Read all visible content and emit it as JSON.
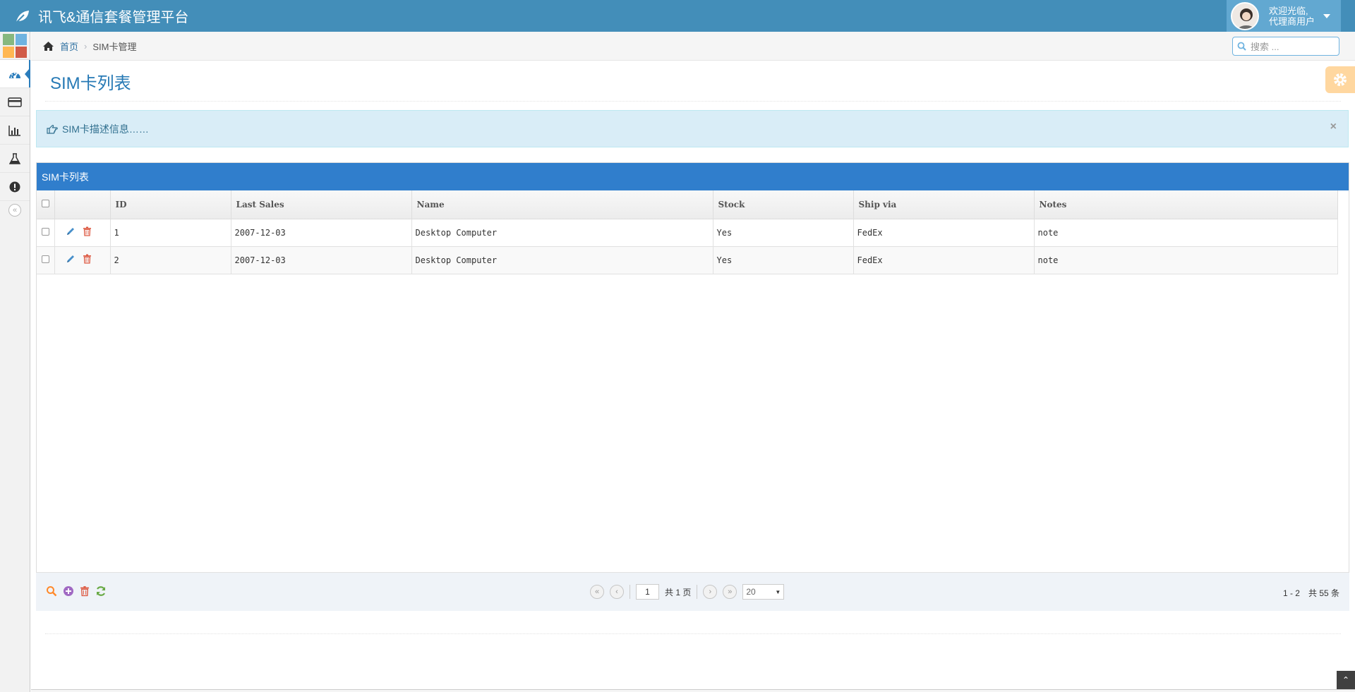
{
  "app": {
    "title": "讯飞&通信套餐管理平台"
  },
  "user": {
    "greeting": "欢迎光临,",
    "role": "代理商用户"
  },
  "breadcrumb": {
    "home": "首页",
    "current": "SIM卡管理"
  },
  "search": {
    "placeholder": "搜索 ..."
  },
  "page": {
    "title": "SIM卡列表"
  },
  "alert": {
    "text": "SIM卡描述信息……"
  },
  "grid": {
    "caption": "SIM卡列表",
    "columns": [
      "ID",
      "Last Sales",
      "Name",
      "Stock",
      "Ship via",
      "Notes"
    ],
    "rows": [
      {
        "id": "1",
        "last_sales": "2007-12-03",
        "name": "Desktop Computer",
        "stock": "Yes",
        "ship_via": "FedEx",
        "notes": "note"
      },
      {
        "id": "2",
        "last_sales": "2007-12-03",
        "name": "Desktop Computer",
        "stock": "Yes",
        "ship_via": "FedEx",
        "notes": "note"
      }
    ]
  },
  "pager": {
    "page": "1",
    "total_pages_text": "共 1 页",
    "rows_per_page": "20",
    "record_info": "1 - 2　共 55 条"
  },
  "colors": {
    "navbar": "#438eb9",
    "caption": "#307ecc",
    "alert_bg": "#d9edf7",
    "accent": "#2679b5"
  }
}
